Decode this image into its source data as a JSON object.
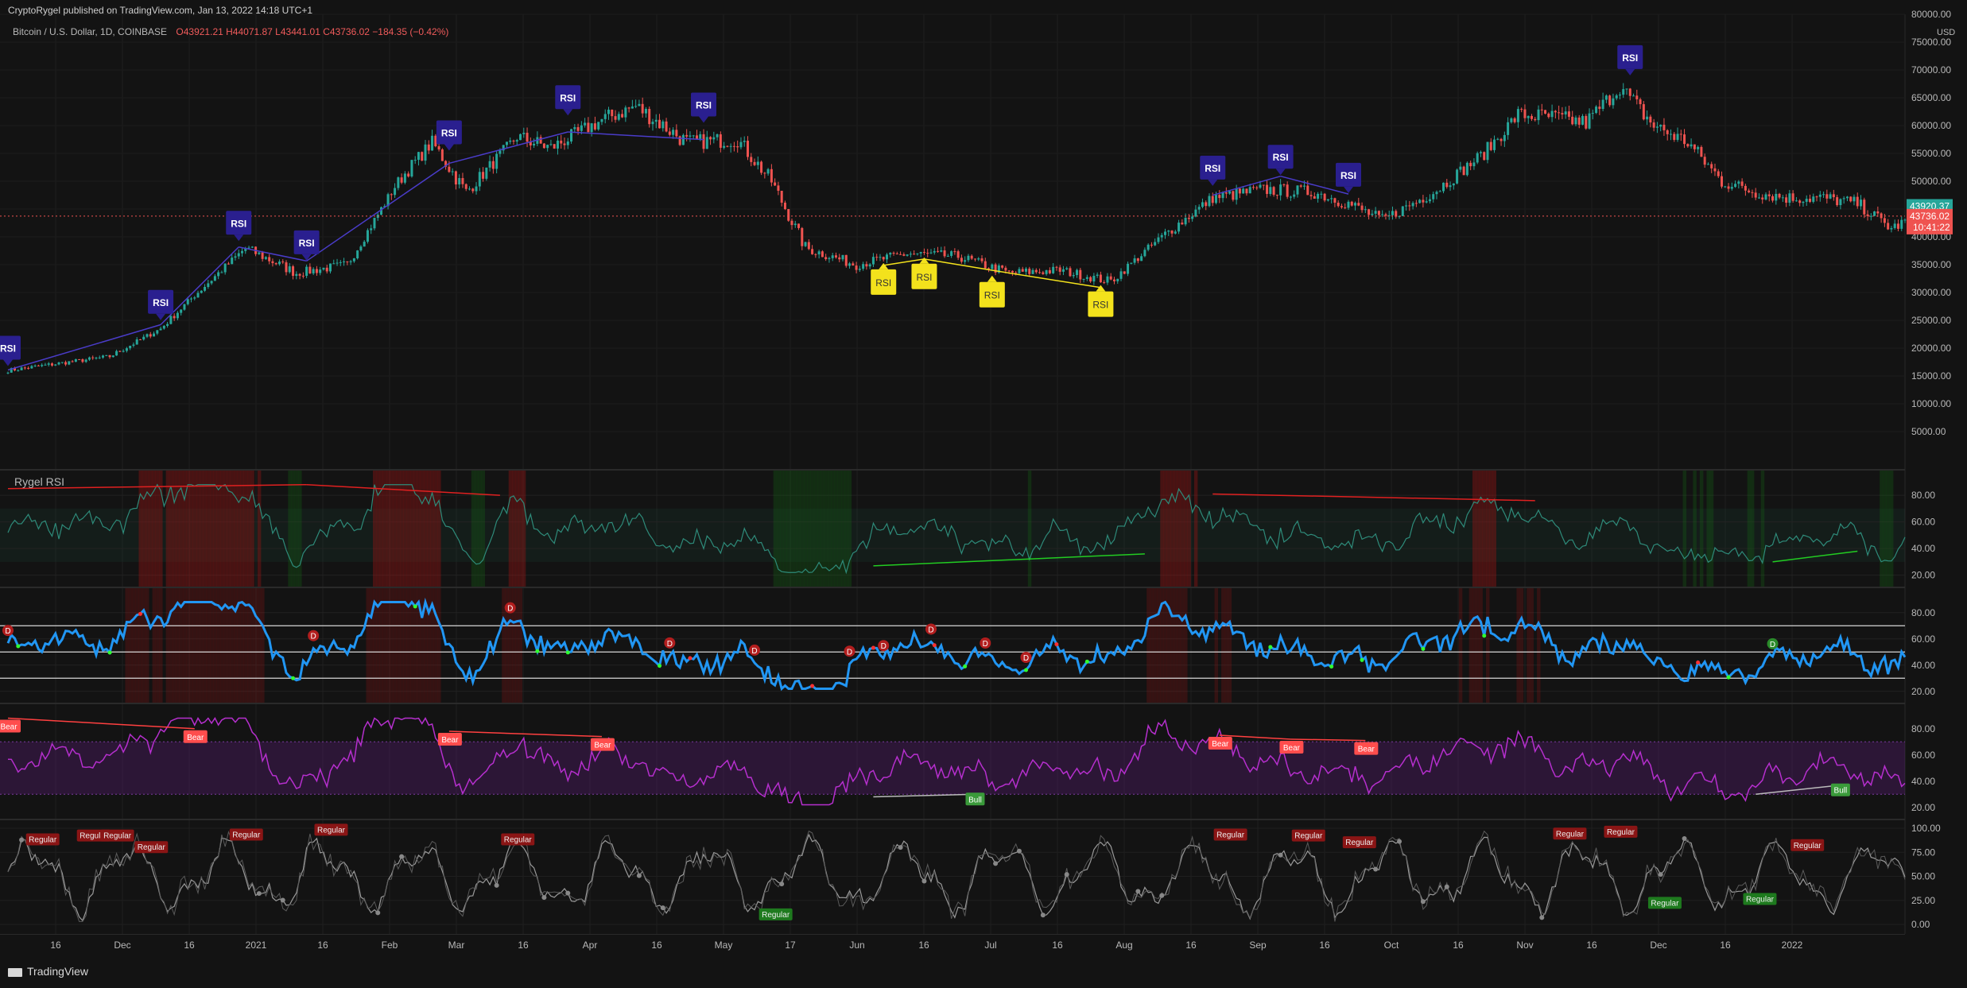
{
  "header": {
    "published": "CryptoRygel published on TradingView.com, Jan 13, 2022 14:18 UTC+1",
    "symbol": "Bitcoin / U.S. Dollar, 1D, COINBASE",
    "ohlc": "O43921.21 H44071.87 L43441.01 C43736.02 −184.35 (−0.42%)"
  },
  "price_axis": {
    "currency": "USD",
    "ticks": [
      "80000.00",
      "75000.00",
      "70000.00",
      "65000.00",
      "60000.00",
      "55000.00",
      "50000.00",
      "45000.00",
      "40000.00",
      "35000.00",
      "30000.00",
      "25000.00",
      "20000.00",
      "15000.00",
      "10000.00",
      "5000.00"
    ],
    "last_price": "43920.37",
    "close_price": "43736.02",
    "countdown": "10:41:22"
  },
  "time_axis": [
    "16",
    "Dec",
    "16",
    "2021",
    "16",
    "Feb",
    "Mar",
    "16",
    "Apr",
    "16",
    "May",
    "17",
    "Jun",
    "16",
    "Jul",
    "16",
    "Aug",
    "16",
    "Sep",
    "16",
    "Oct",
    "16",
    "Nov",
    "16",
    "Dec",
    "16",
    "2022"
  ],
  "rsi_pane_title": "Rygel RSI",
  "osc_ticks": [
    "80.00",
    "60.00",
    "40.00",
    "20.00"
  ],
  "osc_ticks_last": [
    "100.00",
    "75.00",
    "50.00",
    "25.00",
    "0.00"
  ],
  "labels": {
    "rsi": "RSI",
    "d": "D",
    "bear": "Bear",
    "bull": "Bull",
    "regular": "Regular"
  },
  "footer": "TradingView",
  "colors": {
    "bg": "#131313",
    "up": "#26a69a",
    "down": "#ef5350",
    "bear_div": "#2a1f8f",
    "bull_div": "#f3e21c",
    "rsi_line": "#2196f3",
    "purple": "#b62fce",
    "red": "#ff4444",
    "green": "#22aa22"
  },
  "chart_data": {
    "type": "candlestick",
    "title": "Bitcoin / U.S. Dollar, 1D, COINBASE",
    "ylim": [
      0,
      80000
    ],
    "x_range": [
      "2020-11",
      "2022-01-13"
    ],
    "close_path_daily_approx": [
      [
        0,
        16000
      ],
      [
        30,
        18500
      ],
      [
        45,
        23500
      ],
      [
        55,
        29500
      ],
      [
        70,
        38000
      ],
      [
        85,
        33500
      ],
      [
        100,
        35000
      ],
      [
        115,
        50000
      ],
      [
        125,
        57000
      ],
      [
        135,
        48000
      ],
      [
        150,
        58000
      ],
      [
        160,
        56000
      ],
      [
        175,
        61000
      ],
      [
        185,
        63500
      ],
      [
        200,
        57000
      ],
      [
        215,
        57500
      ],
      [
        225,
        50000
      ],
      [
        235,
        38000
      ],
      [
        250,
        35000
      ],
      [
        265,
        37000
      ],
      [
        280,
        36500
      ],
      [
        295,
        33500
      ],
      [
        310,
        34000
      ],
      [
        325,
        32000
      ],
      [
        340,
        40000
      ],
      [
        355,
        47000
      ],
      [
        370,
        48500
      ],
      [
        385,
        48000
      ],
      [
        395,
        46000
      ],
      [
        405,
        43000
      ],
      [
        420,
        48000
      ],
      [
        435,
        55000
      ],
      [
        445,
        62000
      ],
      [
        455,
        61500
      ],
      [
        465,
        60500
      ],
      [
        475,
        67000
      ],
      [
        485,
        60000
      ],
      [
        495,
        57000
      ],
      [
        505,
        50000
      ],
      [
        515,
        48000
      ],
      [
        525,
        47000
      ],
      [
        535,
        47000
      ],
      [
        545,
        46000
      ],
      [
        555,
        41500
      ],
      [
        560,
        43000
      ]
    ],
    "annotations": [
      {
        "label": "RSI",
        "type": "bear"
      },
      {
        "label": "RSI",
        "type": "bear"
      },
      {
        "label": "RSI",
        "type": "bear"
      },
      {
        "label": "RSI",
        "type": "bear"
      },
      {
        "label": "RSI",
        "type": "bear"
      },
      {
        "label": "RSI",
        "type": "bear"
      },
      {
        "label": "RSI",
        "type": "bear"
      },
      {
        "label": "RSI",
        "type": "bear"
      },
      {
        "label": "RSI",
        "type": "bear"
      },
      {
        "label": "RSI",
        "type": "bear"
      },
      {
        "label": "RSI",
        "type": "bear"
      },
      {
        "label": "RSI",
        "type": "bull"
      },
      {
        "label": "RSI",
        "type": "bull"
      },
      {
        "label": "RSI",
        "type": "bull"
      },
      {
        "label": "RSI",
        "type": "bull"
      }
    ],
    "series": [
      {
        "name": "Rygel RSI",
        "ylim": [
          20,
          90
        ]
      },
      {
        "ylim": [
          20,
          90
        ]
      },
      {
        "ylim": [
          20,
          90
        ]
      },
      {
        "ylim": [
          0,
          100
        ]
      }
    ]
  }
}
